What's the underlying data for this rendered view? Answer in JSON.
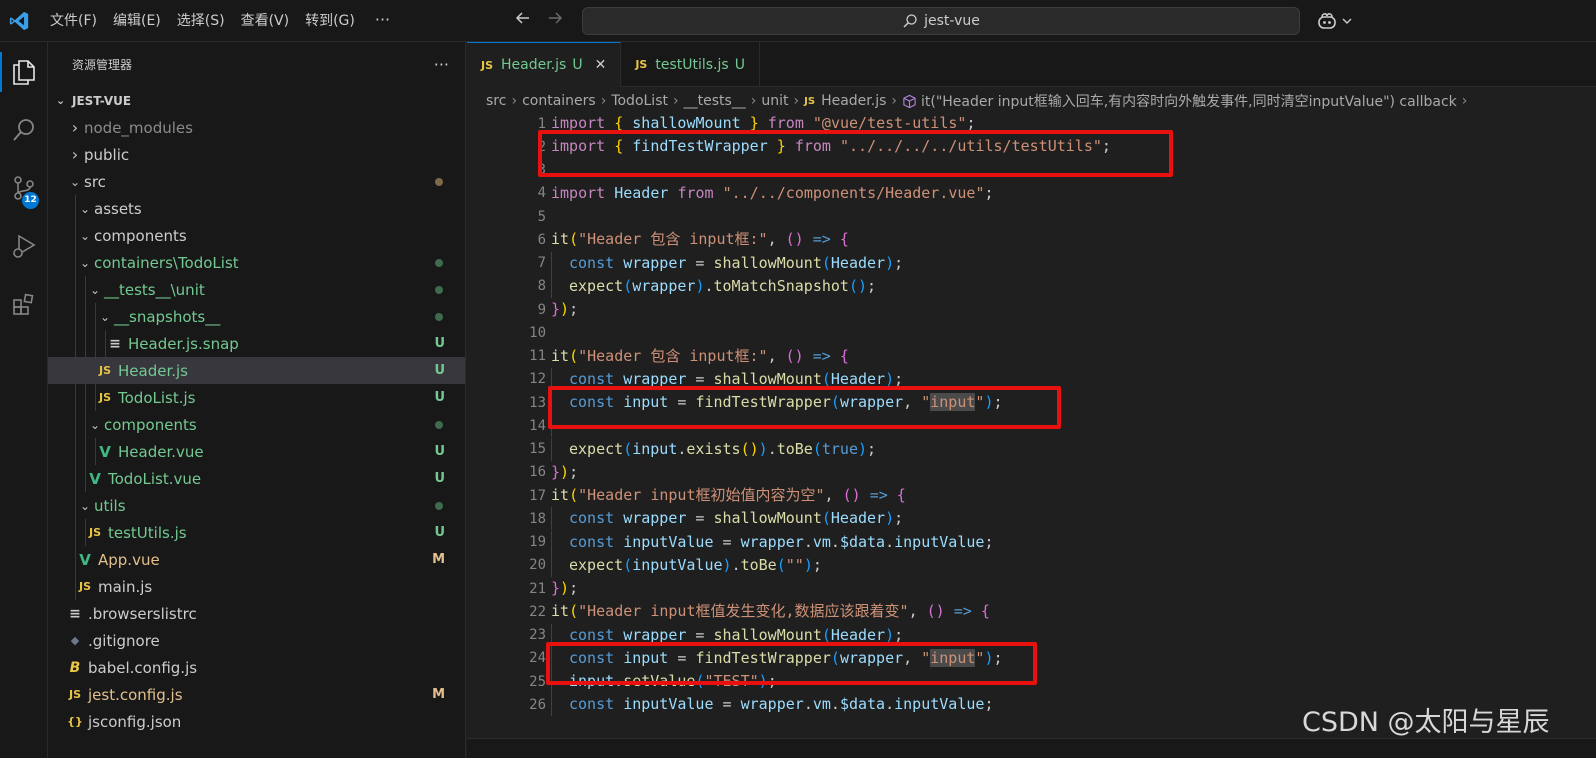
{
  "titlebar": {
    "menu": [
      "文件(F)",
      "编辑(E)",
      "选择(S)",
      "查看(V)",
      "转到(G)"
    ],
    "more": "···",
    "search": "jest-vue"
  },
  "activity": {
    "scm_badge": "12"
  },
  "sidebar": {
    "title": "资源管理器",
    "more": "···",
    "root": "JEST-VUE",
    "items": [
      {
        "label": "node_modules",
        "status": ""
      },
      {
        "label": "public",
        "status": ""
      },
      {
        "label": "src",
        "status": ""
      },
      {
        "label": "assets",
        "status": ""
      },
      {
        "label": "components",
        "status": ""
      },
      {
        "label": "containers\\TodoList",
        "status": ""
      },
      {
        "label": "__tests__\\unit",
        "status": ""
      },
      {
        "label": "__snapshots__",
        "status": ""
      },
      {
        "label": "Header.js.snap",
        "status": "U"
      },
      {
        "label": "Header.js",
        "status": "U"
      },
      {
        "label": "TodoList.js",
        "status": "U"
      },
      {
        "label": "components",
        "status": ""
      },
      {
        "label": "Header.vue",
        "status": "U"
      },
      {
        "label": "TodoList.vue",
        "status": "U"
      },
      {
        "label": "utils",
        "status": ""
      },
      {
        "label": "testUtils.js",
        "status": "U"
      },
      {
        "label": "App.vue",
        "status": "M"
      },
      {
        "label": "main.js",
        "status": ""
      },
      {
        "label": ".browserslistrc",
        "status": ""
      },
      {
        "label": ".gitignore",
        "status": ""
      },
      {
        "label": "babel.config.js",
        "status": ""
      },
      {
        "label": "jest.config.js",
        "status": "M"
      },
      {
        "label": "jsconfig.json",
        "status": ""
      }
    ]
  },
  "editor": {
    "tabs": [
      {
        "name": "Header.js",
        "status": "U",
        "close": "✕"
      },
      {
        "name": "testUtils.js",
        "status": "U"
      }
    ],
    "breadcrumb": [
      "src",
      "containers",
      "TodoList",
      "__tests__",
      "unit",
      "Header.js",
      "it(\"Header input框输入回车,有内容时向外触发事件,同时清空inputValue\") callback"
    ],
    "line_numbers": [
      "1",
      "2",
      "3",
      "4",
      "5",
      "6",
      "7",
      "8",
      "9",
      "10",
      "11",
      "12",
      "13",
      "14",
      "15",
      "16",
      "17",
      "18",
      "19",
      "20",
      "21",
      "22",
      "23",
      "24",
      "25",
      "26"
    ]
  },
  "watermark": "CSDN @太阳与星辰",
  "colors": {
    "accent": "#0078d4",
    "highlight_box": "#e8110f",
    "untracked": "#73c991",
    "modified": "#e2c08d"
  }
}
